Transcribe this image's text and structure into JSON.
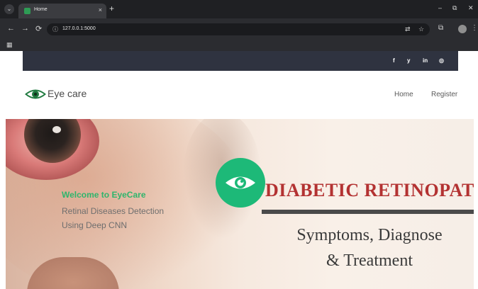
{
  "browser": {
    "tab_title": "Home",
    "tab_close": "×",
    "new_tab": "+",
    "tab_menu": "⌄",
    "window": {
      "minimize": "–",
      "maximize": "⧉",
      "close": "✕"
    },
    "nav": {
      "back": "←",
      "forward": "→",
      "reload": "⟳"
    },
    "url": "127.0.0.1:5000",
    "info_icon": "ⓘ",
    "icons": [
      "translate-icon",
      "star-icon",
      "extensions-icon",
      "profile-avatar",
      "kebab-menu-icon"
    ],
    "glyphs": {
      "translate": "⇄",
      "star": "☆",
      "extensions": "⧉",
      "menu": "⋮",
      "apps": "▦"
    }
  },
  "site": {
    "social": [
      "f",
      "y",
      "in",
      "◎"
    ],
    "logo_text": "Eye care",
    "nav_links": [
      "Home",
      "Register"
    ]
  },
  "hero": {
    "welcome": "Welcome to EyeCare",
    "tagline_line1": "Retinal Diseases Detection",
    "tagline_line2": "Using Deep CNN",
    "banner_title": "DIABETIC RETINOPATH",
    "banner_sub1": "Symptoms, Diagnose",
    "banner_sub2": "& Treatment"
  },
  "colors": {
    "accent_green": "#1db978",
    "title_red": "#b33232",
    "topbar": "#2f3340"
  }
}
